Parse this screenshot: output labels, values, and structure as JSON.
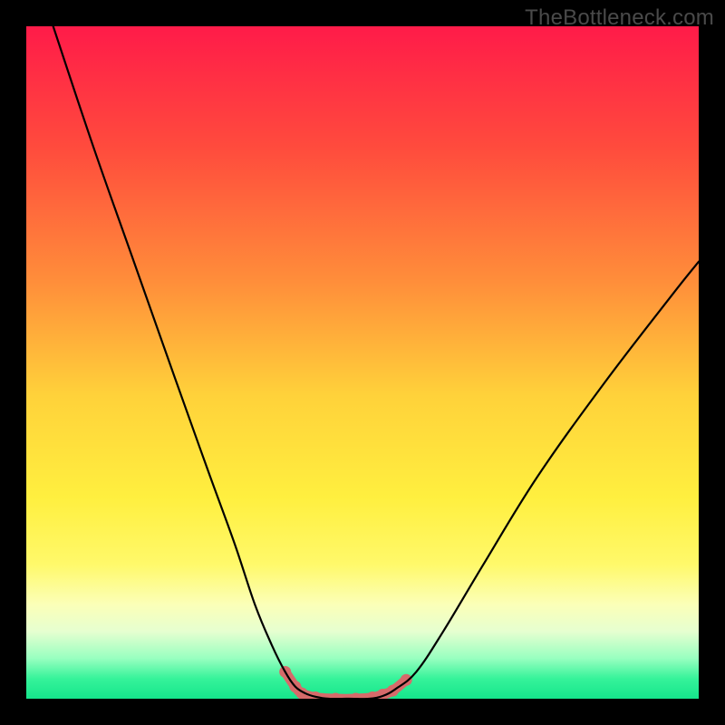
{
  "watermark": "TheBottleneck.com",
  "chart_data": {
    "type": "line",
    "title": "",
    "xlabel": "",
    "ylabel": "",
    "xlim": [
      0,
      100
    ],
    "ylim": [
      0,
      100
    ],
    "background_gradient": {
      "stops": [
        {
          "offset": 0,
          "color": "#ff1b49"
        },
        {
          "offset": 18,
          "color": "#ff4b3d"
        },
        {
          "offset": 38,
          "color": "#ff8e3a"
        },
        {
          "offset": 55,
          "color": "#ffd23a"
        },
        {
          "offset": 70,
          "color": "#ffef3f"
        },
        {
          "offset": 80,
          "color": "#fff96a"
        },
        {
          "offset": 86,
          "color": "#fbffb8"
        },
        {
          "offset": 90,
          "color": "#e6ffd0"
        },
        {
          "offset": 94,
          "color": "#98ffc0"
        },
        {
          "offset": 97,
          "color": "#36f39a"
        },
        {
          "offset": 100,
          "color": "#15e58c"
        }
      ]
    },
    "series": [
      {
        "name": "bottleneck-curve",
        "x": [
          4,
          10,
          16,
          22,
          27,
          31,
          34,
          36.5,
          38.5,
          40,
          41.5,
          43,
          45,
          48,
          51,
          53,
          55,
          58,
          62,
          68,
          76,
          86,
          96,
          100
        ],
        "y": [
          100,
          82,
          65,
          48,
          34,
          23,
          14,
          8,
          4,
          1.8,
          0.8,
          0.3,
          0,
          0,
          0,
          0.4,
          1.5,
          4,
          10,
          20,
          33,
          47,
          60,
          65
        ],
        "stroke": "#000000",
        "stroke_width": 2.2
      }
    ],
    "marker_region": {
      "name": "optimal-markers",
      "color": "#d66a6a",
      "radius": 6.5,
      "thick_stroke_width": 11,
      "points_x": [
        38.5,
        40,
        41,
        43,
        46,
        49,
        51.5,
        53,
        54.5,
        56.5
      ],
      "points_y": [
        4.0,
        1.8,
        0.8,
        0.2,
        0,
        0,
        0.2,
        0.6,
        1.2,
        2.8
      ]
    }
  }
}
